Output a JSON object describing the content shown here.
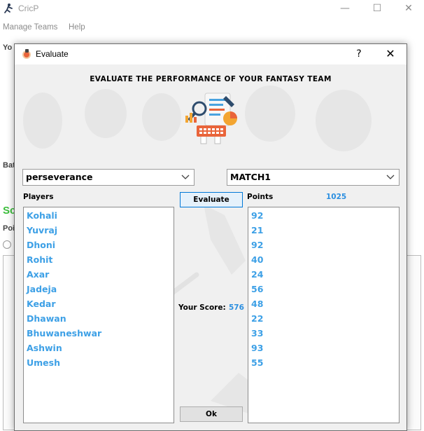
{
  "main_window": {
    "title": "CricP",
    "minimize_glyph": "—",
    "maximize_glyph": "☐",
    "close_glyph": "✕",
    "menu": [
      "Manage Teams",
      "Help"
    ],
    "fragments": {
      "you": "Yo",
      "bat": "Bat",
      "sc": "Sc",
      "poi": "Poi"
    }
  },
  "dialog": {
    "title": "Evaluate",
    "help_glyph": "?",
    "close_glyph": "✕",
    "heading": "EVALUATE THE PERFORMANCE OF YOUR FANTASY TEAM",
    "team_select": {
      "value": "perseverance"
    },
    "match_select": {
      "value": "MATCH1"
    },
    "players_label": "Players",
    "points_label": "Points",
    "total_points": "1025",
    "evaluate_button": "Evaluate",
    "score_label": "Your Score:",
    "score_value": "576",
    "ok_button": "Ok",
    "players": [
      "Kohali",
      "Yuvraj",
      "Dhoni",
      "Rohit",
      "Axar",
      "Jadeja",
      "Kedar",
      "Dhawan",
      "Bhuwaneshwar",
      "Ashwin",
      "Umesh"
    ],
    "points": [
      "92",
      "21",
      "92",
      "40",
      "24",
      "56",
      "48",
      "22",
      "33",
      "93",
      "55"
    ]
  },
  "icons": {
    "app_icon": "cricket-player-icon",
    "dialog_icon": "evaluate-app-icon",
    "illustration": "analytics-report-illustration",
    "dropdown": "chevron-down-icon"
  },
  "colors": {
    "list_text": "#3da0e6",
    "score_text": "#2c8fe0",
    "green_text": "#3cbf3c"
  }
}
